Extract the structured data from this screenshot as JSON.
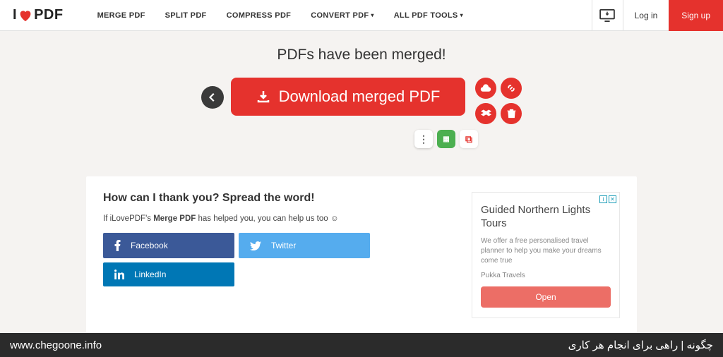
{
  "logo": {
    "left": "I",
    "right": "PDF"
  },
  "nav": {
    "merge": "MERGE PDF",
    "split": "SPLIT PDF",
    "compress": "COMPRESS PDF",
    "convert": "CONVERT PDF",
    "all": "ALL PDF TOOLS"
  },
  "header": {
    "login": "Log in",
    "signup": "Sign up"
  },
  "main": {
    "title": "PDFs have been merged!",
    "download": "Download merged PDF"
  },
  "card": {
    "title": "How can I thank you? Spread the word!",
    "text_prefix": "If iLovePDF's ",
    "text_bold": "Merge PDF",
    "text_suffix": " has helped you, you can help us too ☺",
    "facebook": "Facebook",
    "twitter": "Twitter",
    "linkedin": "LinkedIn"
  },
  "ad": {
    "title": "Guided Northern Lights Tours",
    "desc": "We offer a free personalised travel planner to help you make your dreams come true",
    "brand": "Pukka Travels",
    "cta": "Open"
  },
  "footer": {
    "left": "www.chegoone.info",
    "right": "چگونه | راهی برای انجام هر کاری"
  }
}
